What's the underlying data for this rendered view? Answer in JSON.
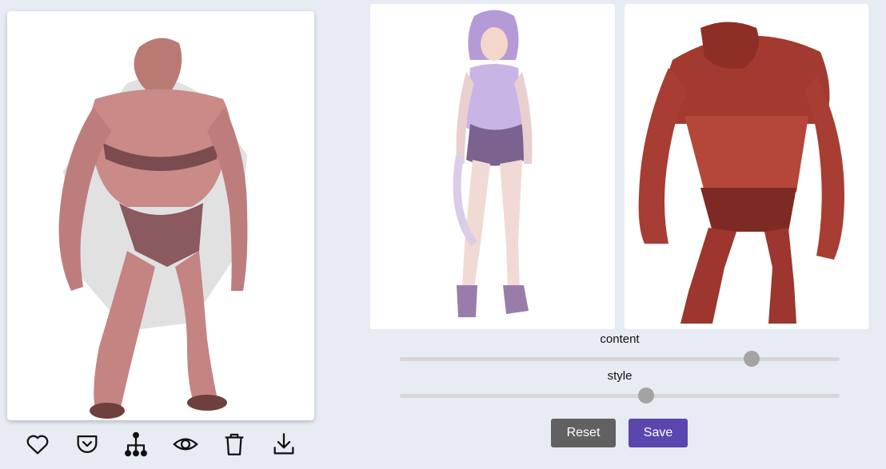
{
  "colors": {
    "page_background": "#e7ebf3",
    "reset_button": "#616161",
    "save_button": "#5b46ad",
    "slider_track": "#d6d6d6",
    "slider_thumb": "#a3a3a3"
  },
  "images": {
    "result": "stylized-result-creature-image",
    "content": "content-image-anime-girl",
    "style": "style-image-red-creature"
  },
  "actions": [
    {
      "name": "favorite-icon"
    },
    {
      "name": "pocket-save-icon"
    },
    {
      "name": "hierarchy-icon"
    },
    {
      "name": "eye-icon"
    },
    {
      "name": "trash-icon"
    },
    {
      "name": "download-icon"
    }
  ],
  "sliders": {
    "content": {
      "label": "content",
      "value": 0.8
    },
    "style": {
      "label": "style",
      "value": 0.56
    }
  },
  "buttons": {
    "reset_label": "Reset",
    "save_label": "Save"
  }
}
